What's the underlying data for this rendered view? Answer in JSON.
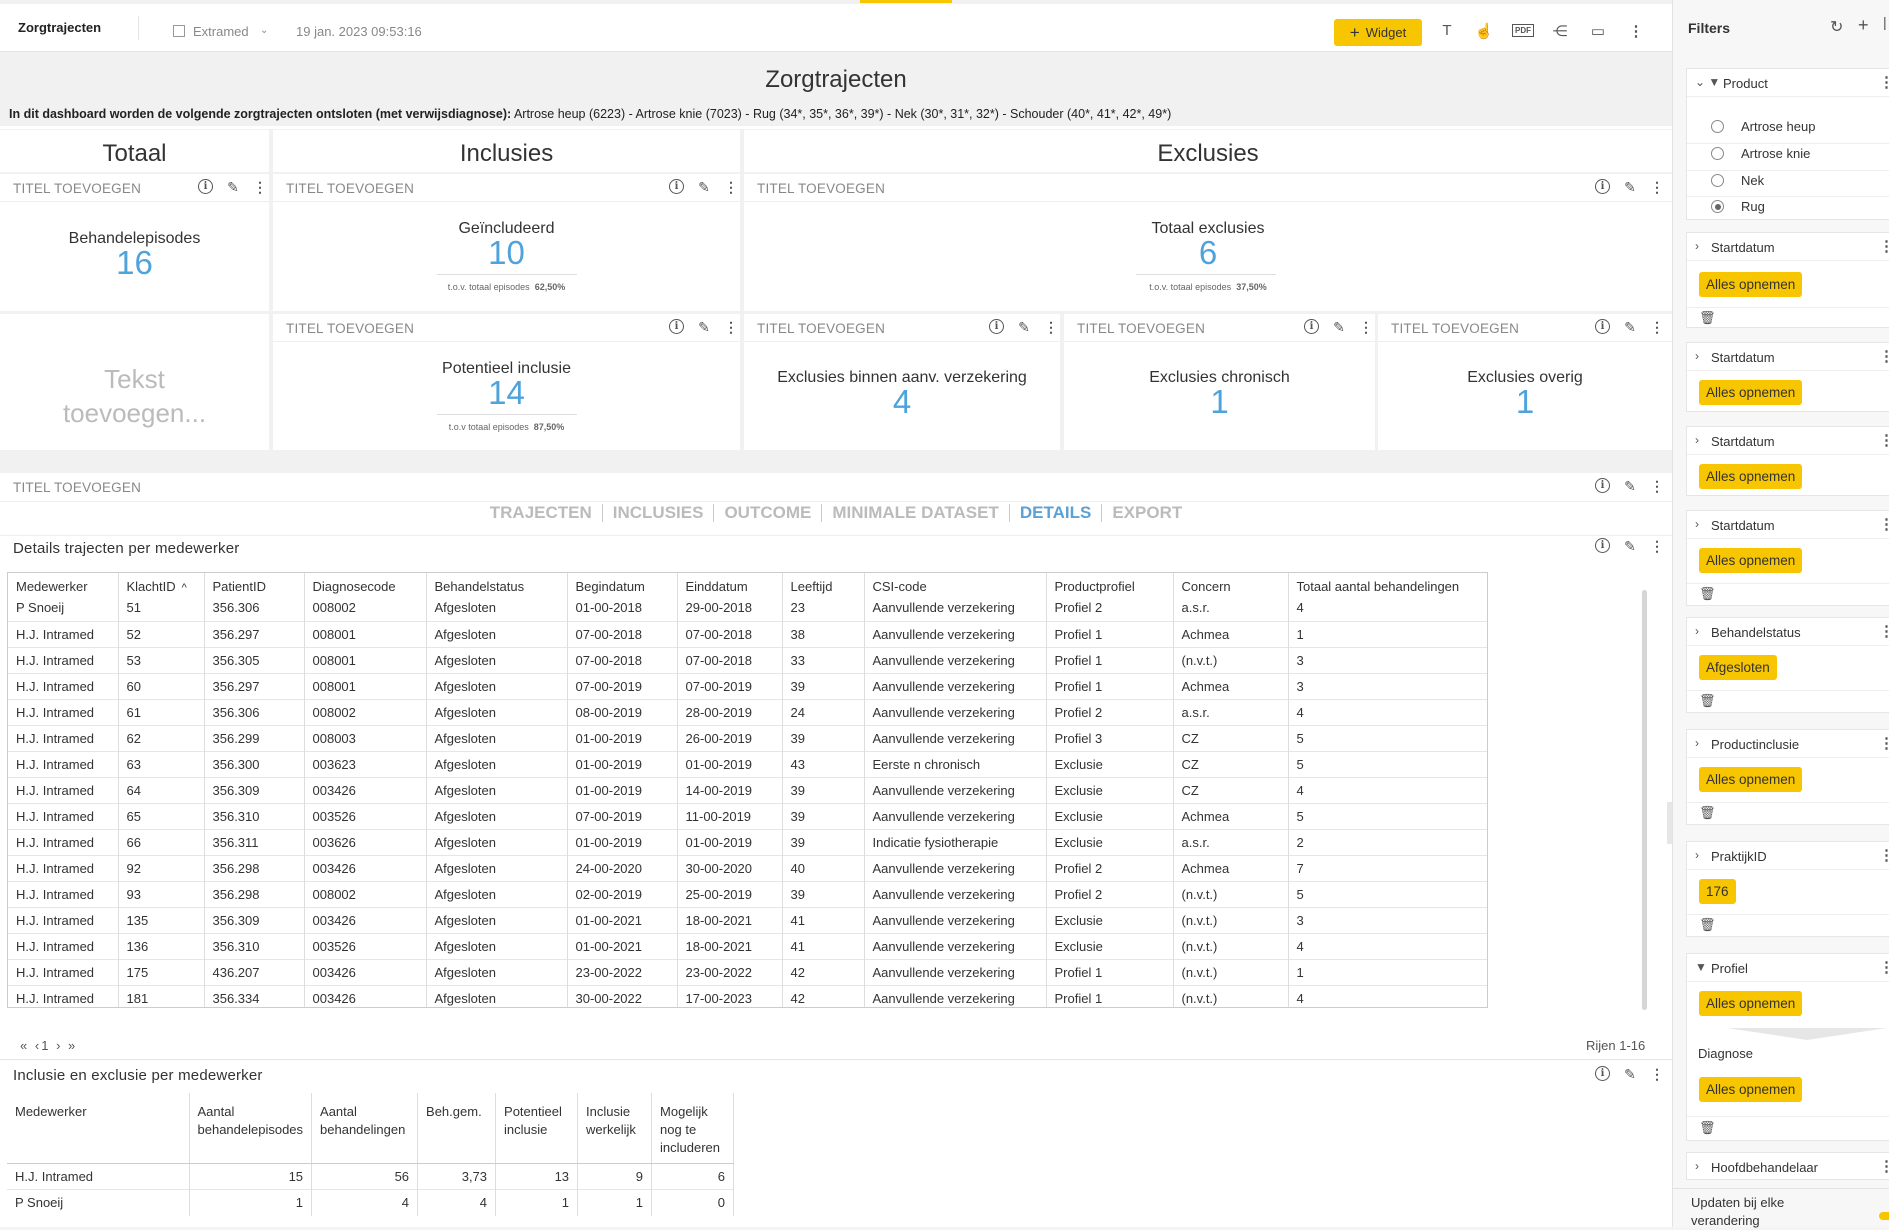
{
  "topbar": {
    "app_title": "Zorgtrajecten",
    "tenant": "Extramed",
    "timestamp": "19 jan. 2023 09:53:16",
    "widget_label": "Widget",
    "pdf_label": "PDF"
  },
  "dashboard": {
    "title": "Zorgtrajecten",
    "description_bold": "In dit dashboard worden de volgende zorgtrajecten ontsloten (met verwijsdiagnose):",
    "description_rest": " Artrose heup (6223) - Artrose knie (7023) - Rug (34*, 35*, 36*, 39*) - Nek (30*, 31*, 32*) - Schouder (40*, 41*, 42*, 49*)"
  },
  "sections": {
    "totaal": "Totaal",
    "inclusies": "Inclusies",
    "exclusies": "Exclusies"
  },
  "placeholder_title": "TITEL TOEVOEGEN",
  "kpis": {
    "behandelepisodes": {
      "label": "Behandelepisodes",
      "value": "16"
    },
    "geincludeerd": {
      "label": "Geïncludeerd",
      "value": "10",
      "sub_label": "t.o.v. totaal episodes",
      "sub_value": "62,50%"
    },
    "totaal_exclusies": {
      "label": "Totaal exclusies",
      "value": "6",
      "sub_label": "t.o.v. totaal episodes",
      "sub_value": "37,50%"
    },
    "potentieel_inclusie": {
      "label": "Potentieel inclusie",
      "value": "14",
      "sub_label": "t.o.v totaal episodes",
      "sub_value": "87,50%"
    },
    "exclusies_binnen": {
      "label": "Exclusies binnen aanv. verzekering",
      "value": "4"
    },
    "exclusies_chronisch": {
      "label": "Exclusies chronisch",
      "value": "1"
    },
    "exclusies_overig": {
      "label": "Exclusies overig",
      "value": "1"
    }
  },
  "text_placeholder": {
    "line1": "Tekst",
    "line2": "toevoegen..."
  },
  "tabs": [
    "TRAJECTEN",
    "INCLUSIES",
    "OUTCOME",
    "MINIMALE DATASET",
    "DETAILS",
    "EXPORT"
  ],
  "active_tab": "DETAILS",
  "details_table": {
    "title": "Details trajecten per medewerker",
    "sort_indicator": "^",
    "columns": [
      "Medewerker",
      "KlachtID",
      "PatientID",
      "Diagnosecode",
      "Behandelstatus",
      "Begindatum",
      "Einddatum",
      "Leeftijd",
      "CSI-code",
      "Productprofiel",
      "Concern",
      "Totaal aantal behandelingen"
    ],
    "rows": [
      [
        "P Snoeij",
        "51",
        "356.306",
        "008002",
        "Afgesloten",
        "01-00-2018",
        "29-00-2018",
        "23",
        "Aanvullende verzekering",
        "Profiel 2",
        "a.s.r.",
        "4"
      ],
      [
        "H.J. Intramed",
        "52",
        "356.297",
        "008001",
        "Afgesloten",
        "07-00-2018",
        "07-00-2018",
        "38",
        "Aanvullende verzekering",
        "Profiel 1",
        "Achmea",
        "1"
      ],
      [
        "H.J. Intramed",
        "53",
        "356.305",
        "008001",
        "Afgesloten",
        "07-00-2018",
        "07-00-2018",
        "33",
        "Aanvullende verzekering",
        "Profiel 1",
        "(n.v.t.)",
        "3"
      ],
      [
        "H.J. Intramed",
        "60",
        "356.297",
        "008001",
        "Afgesloten",
        "07-00-2019",
        "07-00-2019",
        "39",
        "Aanvullende verzekering",
        "Profiel 1",
        "Achmea",
        "3"
      ],
      [
        "H.J. Intramed",
        "61",
        "356.306",
        "008002",
        "Afgesloten",
        "08-00-2019",
        "28-00-2019",
        "24",
        "Aanvullende verzekering",
        "Profiel 2",
        "a.s.r.",
        "4"
      ],
      [
        "H.J. Intramed",
        "62",
        "356.299",
        "008003",
        "Afgesloten",
        "01-00-2019",
        "26-00-2019",
        "39",
        "Aanvullende verzekering",
        "Profiel 3",
        "CZ",
        "5"
      ],
      [
        "H.J. Intramed",
        "63",
        "356.300",
        "003623",
        "Afgesloten",
        "01-00-2019",
        "01-00-2019",
        "43",
        "Eerste n chronisch",
        "Exclusie",
        "CZ",
        "5"
      ],
      [
        "H.J. Intramed",
        "64",
        "356.309",
        "003426",
        "Afgesloten",
        "01-00-2019",
        "14-00-2019",
        "39",
        "Aanvullende verzekering",
        "Exclusie",
        "CZ",
        "4"
      ],
      [
        "H.J. Intramed",
        "65",
        "356.310",
        "003526",
        "Afgesloten",
        "07-00-2019",
        "11-00-2019",
        "39",
        "Aanvullende verzekering",
        "Exclusie",
        "Achmea",
        "5"
      ],
      [
        "H.J. Intramed",
        "66",
        "356.311",
        "003626",
        "Afgesloten",
        "01-00-2019",
        "01-00-2019",
        "39",
        "Indicatie fysiotherapie",
        "Exclusie",
        "a.s.r.",
        "2"
      ],
      [
        "H.J. Intramed",
        "92",
        "356.298",
        "003426",
        "Afgesloten",
        "24-00-2020",
        "30-00-2020",
        "40",
        "Aanvullende verzekering",
        "Profiel 2",
        "Achmea",
        "7"
      ],
      [
        "H.J. Intramed",
        "93",
        "356.298",
        "008002",
        "Afgesloten",
        "02-00-2019",
        "25-00-2019",
        "39",
        "Aanvullende verzekering",
        "Profiel 2",
        "(n.v.t.)",
        "5"
      ],
      [
        "H.J. Intramed",
        "135",
        "356.309",
        "003426",
        "Afgesloten",
        "01-00-2021",
        "18-00-2021",
        "41",
        "Aanvullende verzekering",
        "Exclusie",
        "(n.v.t.)",
        "3"
      ],
      [
        "H.J. Intramed",
        "136",
        "356.310",
        "003526",
        "Afgesloten",
        "01-00-2021",
        "18-00-2021",
        "41",
        "Aanvullende verzekering",
        "Exclusie",
        "(n.v.t.)",
        "4"
      ],
      [
        "H.J. Intramed",
        "175",
        "436.207",
        "003426",
        "Afgesloten",
        "23-00-2022",
        "23-00-2022",
        "42",
        "Aanvullende verzekering",
        "Profiel 1",
        "(n.v.t.)",
        "1"
      ],
      [
        "H.J. Intramed",
        "181",
        "356.334",
        "003426",
        "Afgesloten",
        "30-00-2022",
        "17-00-2023",
        "42",
        "Aanvullende verzekering",
        "Profiel 1",
        "(n.v.t.)",
        "4"
      ]
    ],
    "pager": {
      "first": "«",
      "prev": "‹",
      "page": "1",
      "next": "›",
      "last": "»"
    },
    "rows_info": "Rijen 1-16"
  },
  "summary_table": {
    "title": "Inclusie en exclusie per medewerker",
    "columns": [
      "Medewerker",
      "Aantal behandelepisodes",
      "Aantal behandelingen",
      "Beh.gem.",
      "Potentieel inclusie",
      "Inclusie werkelijk",
      "Mogelijk nog te includeren"
    ],
    "rows": [
      [
        "H.J. Intramed",
        "15",
        "56",
        "3,73",
        "13",
        "9",
        "6"
      ],
      [
        "P Snoeij",
        "1",
        "4",
        "4",
        "1",
        "1",
        "0"
      ]
    ]
  },
  "filters": {
    "title": "Filters",
    "product": {
      "label": "Product",
      "options": [
        "Artrose heup",
        "Artrose knie",
        "Nek",
        "Rug"
      ],
      "selected": "Rug"
    },
    "startdatum_1": {
      "label": "Startdatum",
      "value": "Alles opnemen"
    },
    "startdatum_2": {
      "label": "Startdatum",
      "value": "Alles opnemen"
    },
    "startdatum_3": {
      "label": "Startdatum",
      "value": "Alles opnemen"
    },
    "startdatum_4": {
      "label": "Startdatum",
      "value": "Alles opnemen"
    },
    "behandelstatus": {
      "label": "Behandelstatus",
      "value": "Afgesloten"
    },
    "productinclusie": {
      "label": "Productinclusie",
      "value": "Alles opnemen"
    },
    "praktijkid": {
      "label": "PraktijkID",
      "value": "176"
    },
    "profiel": {
      "label": "Profiel",
      "value": "Alles opnemen"
    },
    "diagnose": {
      "label": "Diagnose",
      "value": "Alles opnemen"
    },
    "hoofdbehandelaar": {
      "label": "Hoofdbehandelaar"
    },
    "update_label": "Updaten bij elke verandering"
  },
  "colors": {
    "accent": "#f7c600",
    "kpi_blue": "#4ea3dc",
    "active_tab": "#5aa2d6"
  }
}
